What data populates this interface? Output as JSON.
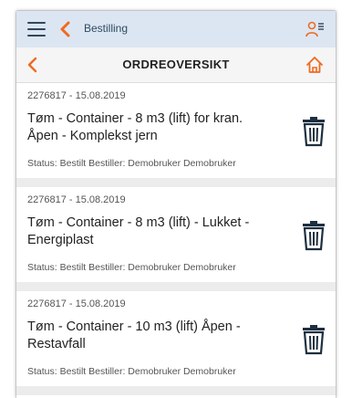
{
  "topbar": {
    "breadcrumb": "Bestilling",
    "menu_icon": "hamburger-icon",
    "back_icon": "chevron-left-icon",
    "user_icon": "user-list-icon"
  },
  "header": {
    "title": "ORDREOVERSIKT",
    "back_icon": "chevron-left-icon",
    "home_icon": "home-icon"
  },
  "colors": {
    "accent": "#f06a1f",
    "topbar_bg": "#dce6f2",
    "trash": "#1e2f3f"
  },
  "orders": [
    {
      "id_date": "2276817 - 15.08.2019",
      "description": "Tøm - Container - 8 m3 (lift) for kran. Åpen - Komplekst jern",
      "status": "Status: Bestilt Bestiller: Demobruker Demobruker"
    },
    {
      "id_date": "2276817 - 15.08.2019",
      "description": "Tøm - Container - 8 m3 (lift) - Lukket - Energiplast",
      "status": "Status: Bestilt Bestiller: Demobruker Demobruker"
    },
    {
      "id_date": "2276817 - 15.08.2019",
      "description": "Tøm - Container - 10 m3 (lift) Åpen - Restavfall",
      "status": "Status: Bestilt Bestiller: Demobruker Demobruker"
    }
  ]
}
